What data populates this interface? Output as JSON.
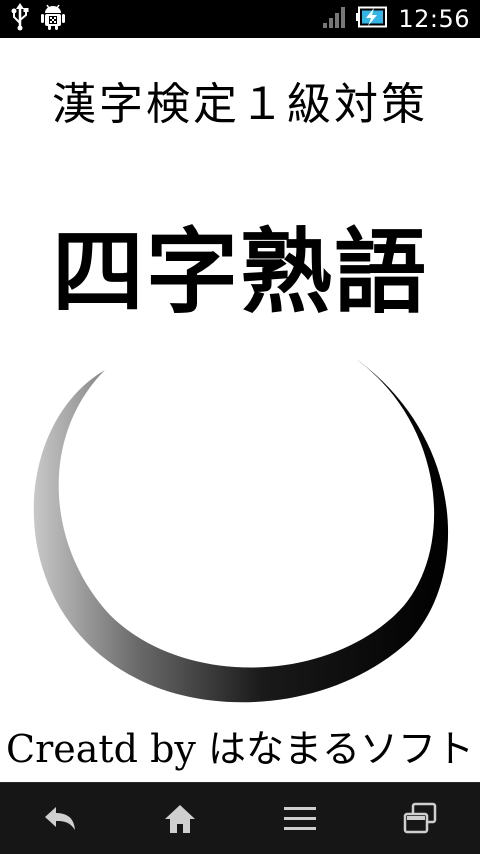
{
  "status_bar": {
    "time": "12:56",
    "icons": [
      "usb-icon",
      "android-debug-icon",
      "signal-icon",
      "battery-charging-icon"
    ]
  },
  "main": {
    "subtitle": "漢字検定１級対策",
    "title": "四字熟語",
    "credit": "Creatd by はなまるソフト"
  },
  "nav_bar": {
    "buttons": [
      "back-icon",
      "home-icon",
      "menu-icon",
      "recent-apps-icon"
    ]
  },
  "colors": {
    "background": "#ffffff",
    "text": "#000000",
    "status_bar": "#000000",
    "nav_bar": "#161616"
  }
}
